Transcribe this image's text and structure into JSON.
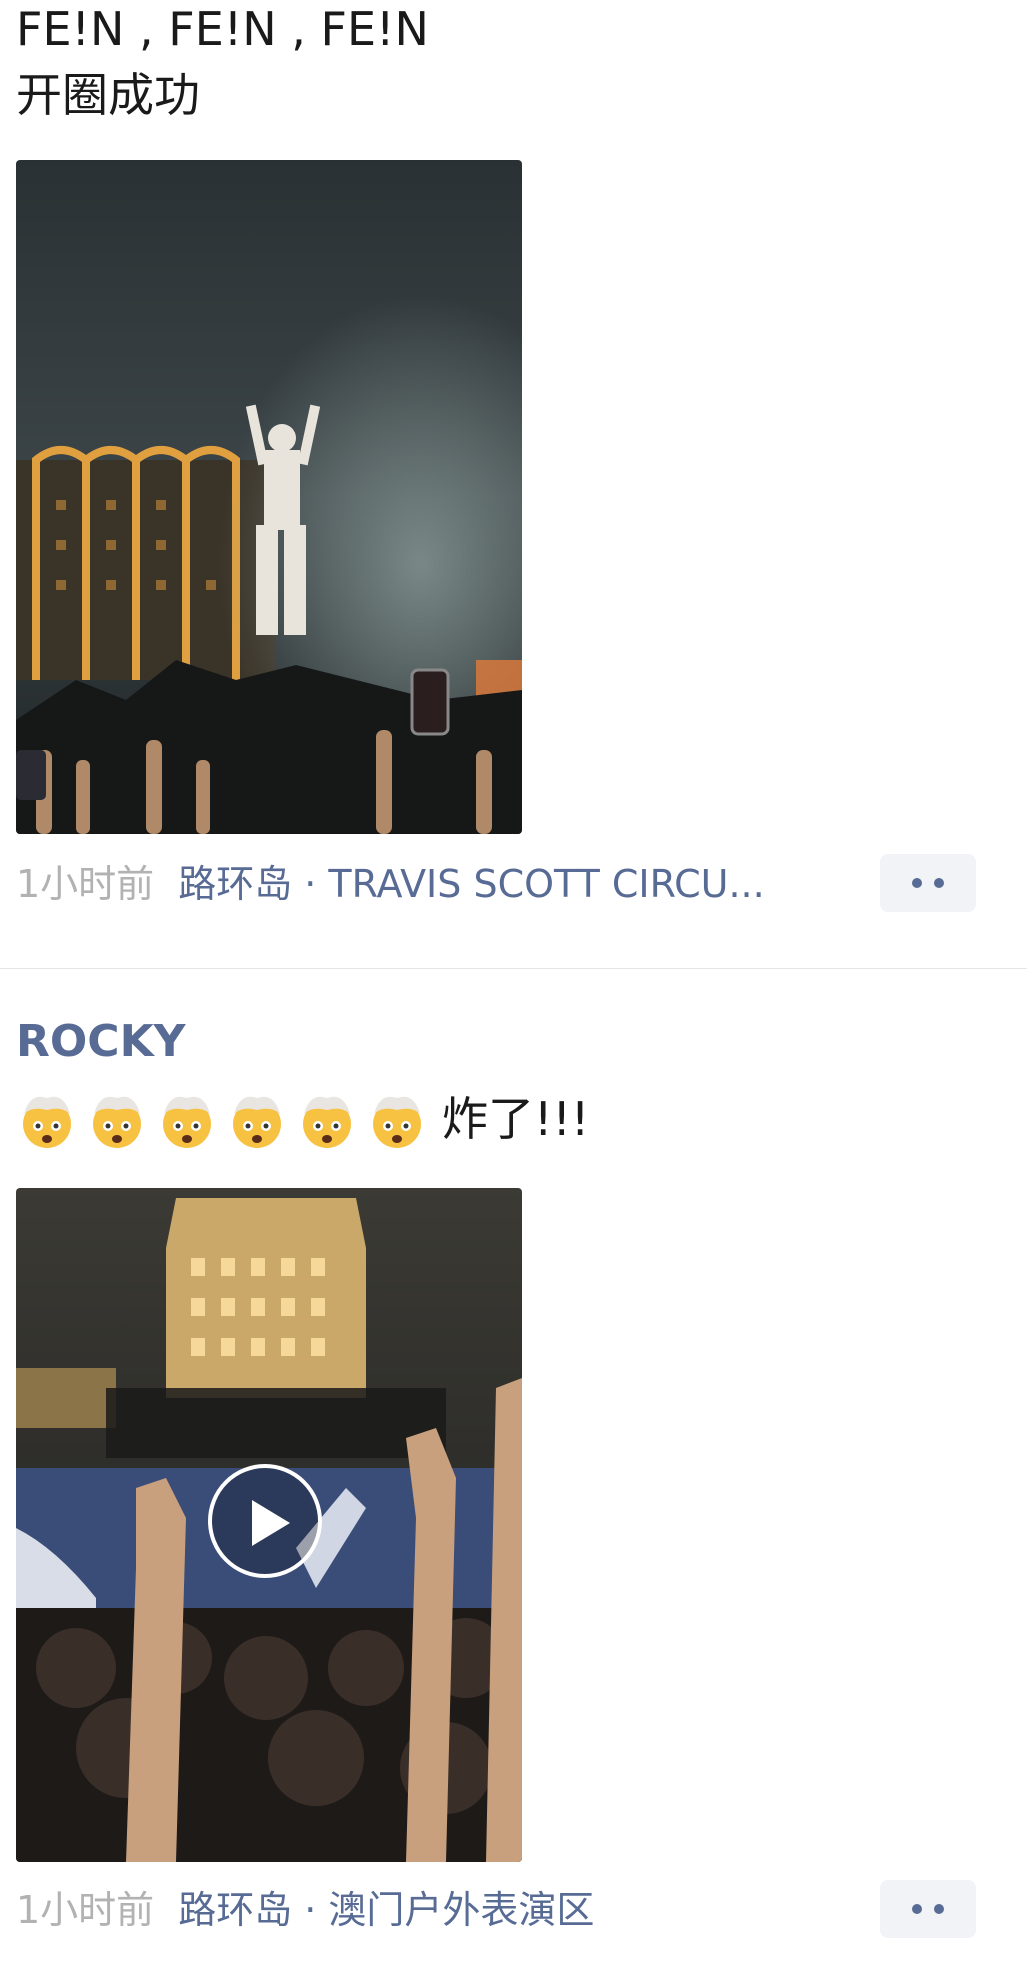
{
  "post1": {
    "text_line1": "FE!N , FE!N , FE!N",
    "text_line2": "开圈成功",
    "time": "1小时前",
    "location": "路环岛 · TRAVIS SCOTT CIRCU..."
  },
  "post2": {
    "author": "ROCKY",
    "emoji_icon": "exploding-head-icon",
    "emoji_count": 6,
    "text": "炸了!!!",
    "time": "1小时前",
    "location": "路环岛 · 澳门户外表演区"
  },
  "colors": {
    "link": "#576b95",
    "time": "#b2b2b2",
    "more_button_bg": "#f2f3f6"
  }
}
